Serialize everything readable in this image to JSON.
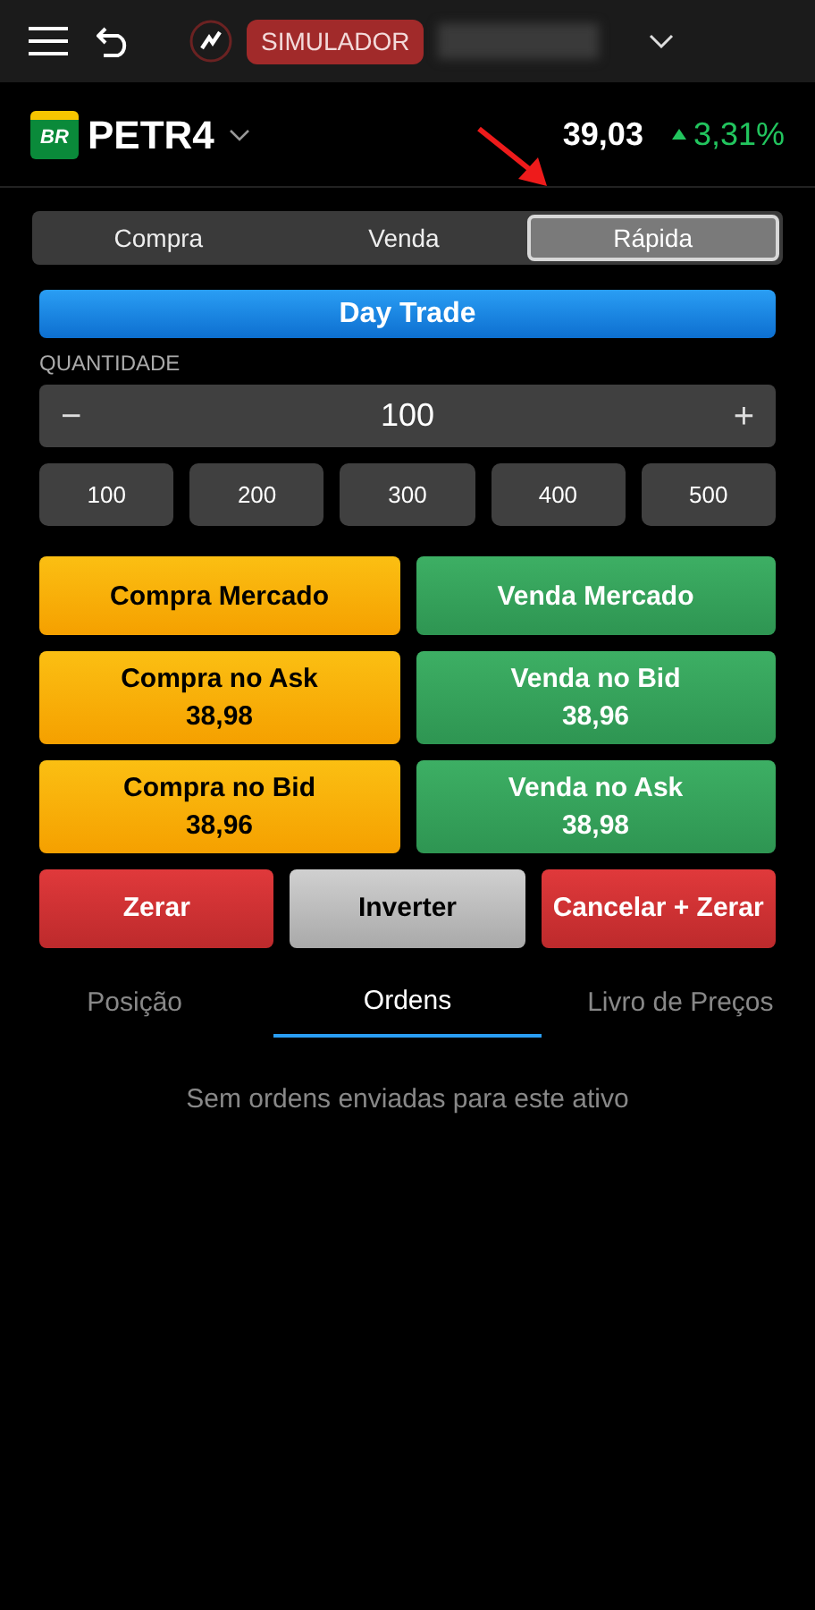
{
  "header": {
    "mode_badge": "SIMULADOR"
  },
  "ticker": {
    "symbol": "PETR4",
    "logo_text": "BR",
    "price": "39,03",
    "change": "3,31%",
    "rising": true
  },
  "order_types": [
    {
      "label": "Compra",
      "selected": false
    },
    {
      "label": "Venda",
      "selected": false
    },
    {
      "label": "Rápida",
      "selected": true
    }
  ],
  "day_trade": "Day Trade",
  "quantity": {
    "label": "QUANTIDADE",
    "value": "100",
    "minus": "−",
    "plus": "+",
    "presets": [
      "100",
      "200",
      "300",
      "400",
      "500"
    ]
  },
  "actions": [
    {
      "kind": "buy",
      "label": "Compra Mercado"
    },
    {
      "kind": "sell",
      "label": "Venda Mercado"
    },
    {
      "kind": "buy",
      "label": "Compra no Ask",
      "price": "38,98"
    },
    {
      "kind": "sell",
      "label": "Venda no Bid",
      "price": "38,96"
    },
    {
      "kind": "buy",
      "label": "Compra no Bid",
      "price": "38,96"
    },
    {
      "kind": "sell",
      "label": "Venda no Ask",
      "price": "38,98"
    }
  ],
  "bottom_actions": [
    {
      "kind": "danger",
      "label": "Zerar"
    },
    {
      "kind": "neutral",
      "label": "Inverter"
    },
    {
      "kind": "danger",
      "label": "Cancelar + Zerar"
    }
  ],
  "tabs": [
    {
      "label": "Posição",
      "selected": false
    },
    {
      "label": "Ordens",
      "selected": true
    },
    {
      "label": "Livro de Preços",
      "selected": false
    }
  ],
  "empty_message": "Sem ordens enviadas para este ativo"
}
